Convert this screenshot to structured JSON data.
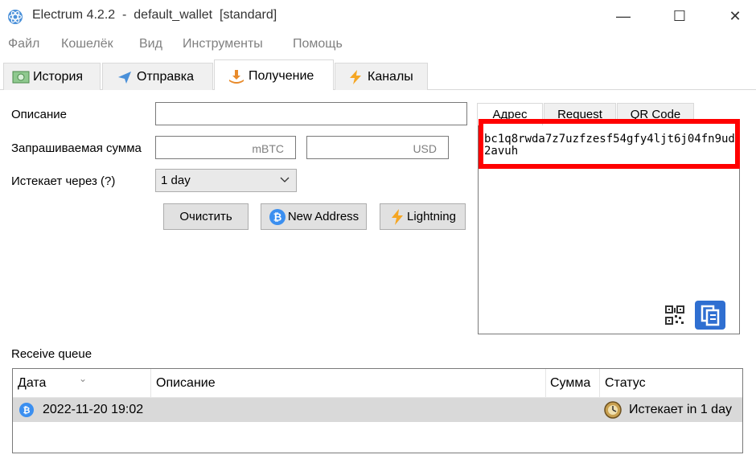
{
  "window": {
    "title": "Electrum 4.2.2  -  default_wallet  [standard]",
    "minimize": "—",
    "maximize": "☐",
    "close": "✕"
  },
  "menu": [
    "Файл",
    "Кошелёк",
    "Вид",
    "Инструменты",
    "Помощь"
  ],
  "tabs": [
    {
      "label": "История",
      "icon": "history-icon"
    },
    {
      "label": "Отправка",
      "icon": "send-icon"
    },
    {
      "label": "Получение",
      "icon": "receive-icon",
      "active": true
    },
    {
      "label": "Каналы",
      "icon": "lightning-icon"
    }
  ],
  "form": {
    "description_label": "Описание",
    "description_value": "",
    "amount_label": "Запрашиваемая сумма",
    "amount_unit_btc": "mBTC",
    "amount_unit_fiat": "USD",
    "expires_label": "Истекает через (?)",
    "expires_value": "1 day",
    "clear_button": "Очистить",
    "new_address_button": "New Address",
    "lightning_button": "Lightning"
  },
  "right_panel": {
    "tabs": [
      "Адрес",
      "Request",
      "QR Code"
    ],
    "active_tab": "Адрес",
    "address": "bc1q8rwda7z7uzfzesf54gfy4ljt6j04fn9ud2avuh"
  },
  "queue": {
    "label": "Receive queue",
    "columns": [
      "Дата",
      "Описание",
      "Сумма",
      "Статус"
    ],
    "rows": [
      {
        "date": "2022-11-20 19:02",
        "description": "",
        "amount": "",
        "status": "Истекает in 1 day"
      }
    ]
  },
  "colors": {
    "highlight": "#ff0000",
    "accent_blue": "#2f6fd1",
    "bitcoin_blue": "#3b8ff0",
    "lightning_orange": "#f5a623"
  }
}
